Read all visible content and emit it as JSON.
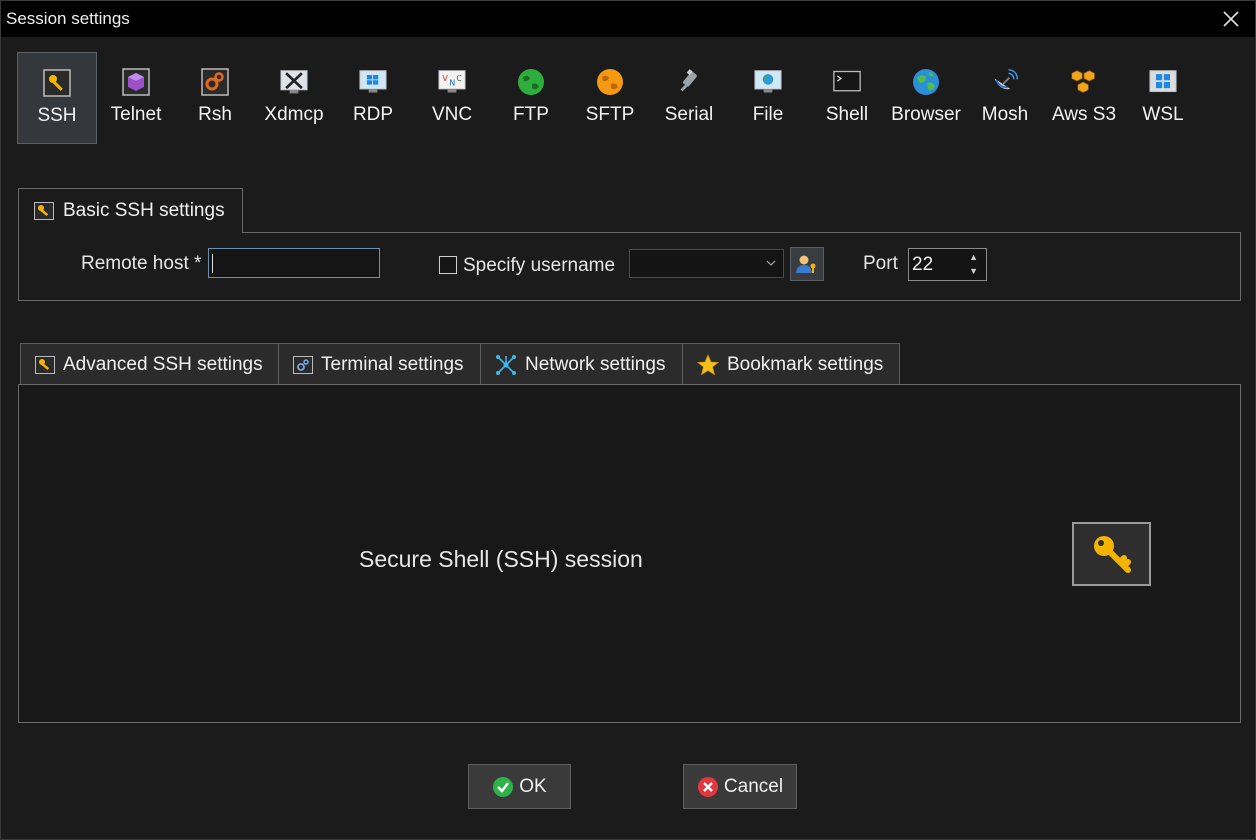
{
  "window": {
    "title": "Session settings"
  },
  "protocols": [
    {
      "label": "SSH",
      "icon": "key-icon",
      "active": true
    },
    {
      "label": "Telnet",
      "icon": "telnet-cube-icon",
      "active": false
    },
    {
      "label": "Rsh",
      "icon": "rsh-gears-icon",
      "active": false
    },
    {
      "label": "Xdmcp",
      "icon": "xdmcp-x-icon",
      "active": false
    },
    {
      "label": "RDP",
      "icon": "rdp-monitor-icon",
      "active": false
    },
    {
      "label": "VNC",
      "icon": "vnc-icon",
      "active": false
    },
    {
      "label": "FTP",
      "icon": "ftp-globe-icon",
      "active": false
    },
    {
      "label": "SFTP",
      "icon": "sftp-globe-icon",
      "active": false
    },
    {
      "label": "Serial",
      "icon": "serial-plug-icon",
      "active": false
    },
    {
      "label": "File",
      "icon": "file-monitor-icon",
      "active": false
    },
    {
      "label": "Shell",
      "icon": "shell-terminal-icon",
      "active": false
    },
    {
      "label": "Browser",
      "icon": "browser-earth-icon",
      "active": false
    },
    {
      "label": "Mosh",
      "icon": "mosh-satellite-icon",
      "active": false
    },
    {
      "label": "Aws S3",
      "icon": "aws-s3-cubes-icon",
      "active": false
    },
    {
      "label": "WSL",
      "icon": "wsl-windows-icon",
      "active": false
    }
  ],
  "basic": {
    "tab_label": "Basic SSH settings",
    "remote_host_label": "Remote host *",
    "remote_host_value": "",
    "specify_username_label": "Specify username",
    "specify_username_checked": false,
    "username_value": "",
    "port_label": "Port",
    "port_value": "22"
  },
  "subtabs": [
    {
      "label": "Advanced SSH settings",
      "icon": "wrench-icon"
    },
    {
      "label": "Terminal settings",
      "icon": "terminal-settings-icon"
    },
    {
      "label": "Network settings",
      "icon": "network-icon"
    },
    {
      "label": "Bookmark settings",
      "icon": "star-icon"
    }
  ],
  "panel": {
    "description": "Secure Shell (SSH) session"
  },
  "buttons": {
    "ok": "OK",
    "cancel": "Cancel"
  },
  "colors": {
    "accent_border": "#6d8fb0",
    "active_tab_bg": "#34383d",
    "ok_green": "#2fb24a",
    "cancel_red": "#e0383e"
  }
}
